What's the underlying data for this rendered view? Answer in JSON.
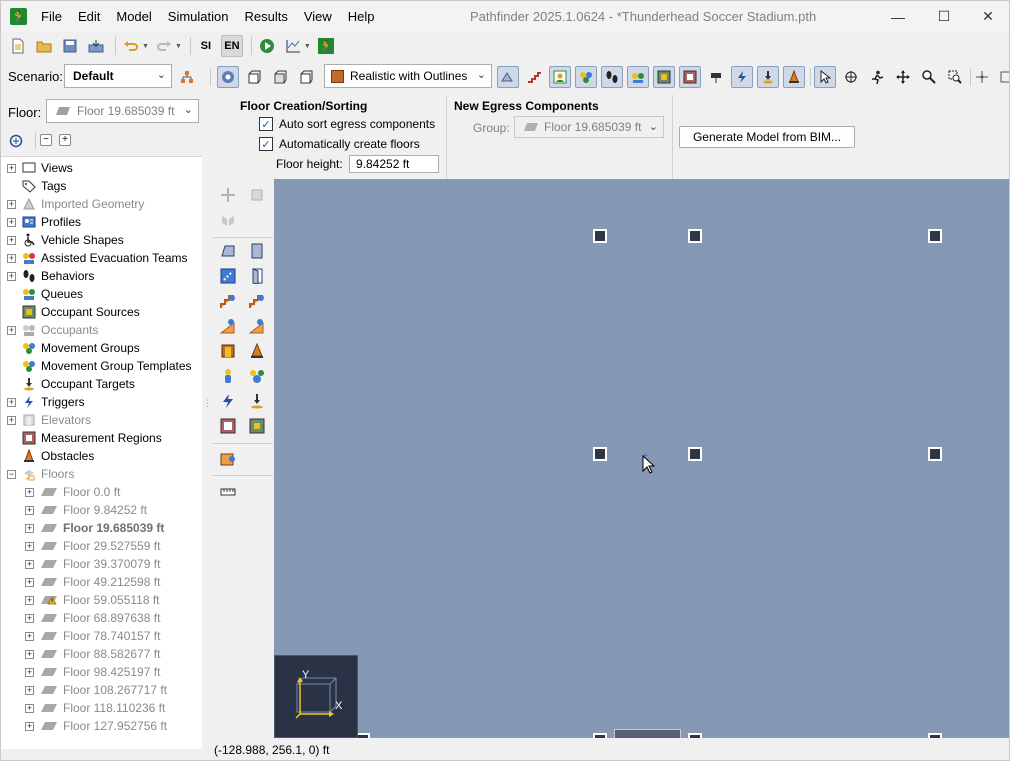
{
  "window": {
    "title": "Pathfinder 2025.1.0624 - *Thunderhead Soccer Stadium.pth",
    "minimize": "—",
    "maximize": "☐",
    "close": "✕"
  },
  "menu": [
    "File",
    "Edit",
    "Model",
    "Simulation",
    "Results",
    "View",
    "Help"
  ],
  "toolbar1": {
    "units_si": "SI",
    "units_en": "EN"
  },
  "toolbar2": {
    "scenario_label": "Scenario:",
    "scenario_value": "Default",
    "render_mode": "Realistic with Outlines"
  },
  "floor_selector": {
    "label": "Floor:",
    "value": "Floor 19.685039 ft"
  },
  "ribbon": {
    "section1_title": "Floor Creation/Sorting",
    "auto_sort_label": "Auto sort egress components",
    "auto_sort_checked": true,
    "auto_create_label": "Automatically create floors",
    "auto_create_checked": true,
    "floor_height_label": "Floor height:",
    "floor_height_value": "9.84252 ft",
    "section2_title": "New Egress Components",
    "group_label": "Group:",
    "group_value": "Floor 19.685039 ft",
    "generate_button": "Generate Model from BIM..."
  },
  "tree": {
    "items": [
      {
        "label": "Views",
        "expandable": true,
        "icon": "views-icon",
        "grey": false
      },
      {
        "label": "Tags",
        "expandable": false,
        "icon": "tag-icon",
        "grey": false
      },
      {
        "label": "Imported Geometry",
        "expandable": true,
        "icon": "geometry-icon",
        "grey": true
      },
      {
        "label": "Profiles",
        "expandable": true,
        "icon": "profile-icon",
        "grey": false
      },
      {
        "label": "Vehicle Shapes",
        "expandable": true,
        "icon": "wheelchair-icon",
        "grey": false
      },
      {
        "label": "Assisted Evacuation Teams",
        "expandable": true,
        "icon": "team-icon",
        "grey": false
      },
      {
        "label": "Behaviors",
        "expandable": true,
        "icon": "footsteps-icon",
        "grey": false
      },
      {
        "label": "Queues",
        "expandable": false,
        "icon": "queue-icon",
        "grey": false
      },
      {
        "label": "Occupant Sources",
        "expandable": false,
        "icon": "source-icon",
        "grey": false
      },
      {
        "label": "Occupants",
        "expandable": true,
        "icon": "occupants-icon",
        "grey": true
      },
      {
        "label": "Movement Groups",
        "expandable": false,
        "icon": "group-icon",
        "grey": false
      },
      {
        "label": "Movement Group Templates",
        "expandable": false,
        "icon": "group-template-icon",
        "grey": false
      },
      {
        "label": "Occupant Targets",
        "expandable": false,
        "icon": "target-icon",
        "grey": false
      },
      {
        "label": "Triggers",
        "expandable": true,
        "icon": "lightning-icon",
        "grey": false
      },
      {
        "label": "Elevators",
        "expandable": true,
        "icon": "elevator-icon",
        "grey": true
      },
      {
        "label": "Measurement Regions",
        "expandable": false,
        "icon": "region-icon",
        "grey": false
      },
      {
        "label": "Obstacles",
        "expandable": false,
        "icon": "cone-icon",
        "grey": false
      },
      {
        "label": "Floors",
        "expandable": true,
        "expanded": true,
        "icon": "floors-icon",
        "grey": true
      }
    ],
    "floors": [
      "Floor 0.0 ft",
      "Floor 9.84252 ft",
      "Floor 19.685039 ft",
      "Floor 29.527559 ft",
      "Floor 39.370079 ft",
      "Floor 49.212598 ft",
      "Floor 59.055118 ft",
      "Floor 68.897638 ft",
      "Floor 78.740157 ft",
      "Floor 88.582677 ft",
      "Floor 98.425197 ft",
      "Floor 108.267717 ft",
      "Floor 118.110236 ft",
      "Floor 127.952756 ft"
    ],
    "active_floor_index": 2,
    "warning_floor_index": 6
  },
  "canvas": {
    "axis_x": "X",
    "axis_y": "Y"
  },
  "status": {
    "coordinates": "(-128.988, 256.1, 0) ft"
  },
  "colors": {
    "canvas_bg": "#8599b5",
    "node_fill": "#2e3646",
    "brand_green": "#1e8a2e"
  }
}
